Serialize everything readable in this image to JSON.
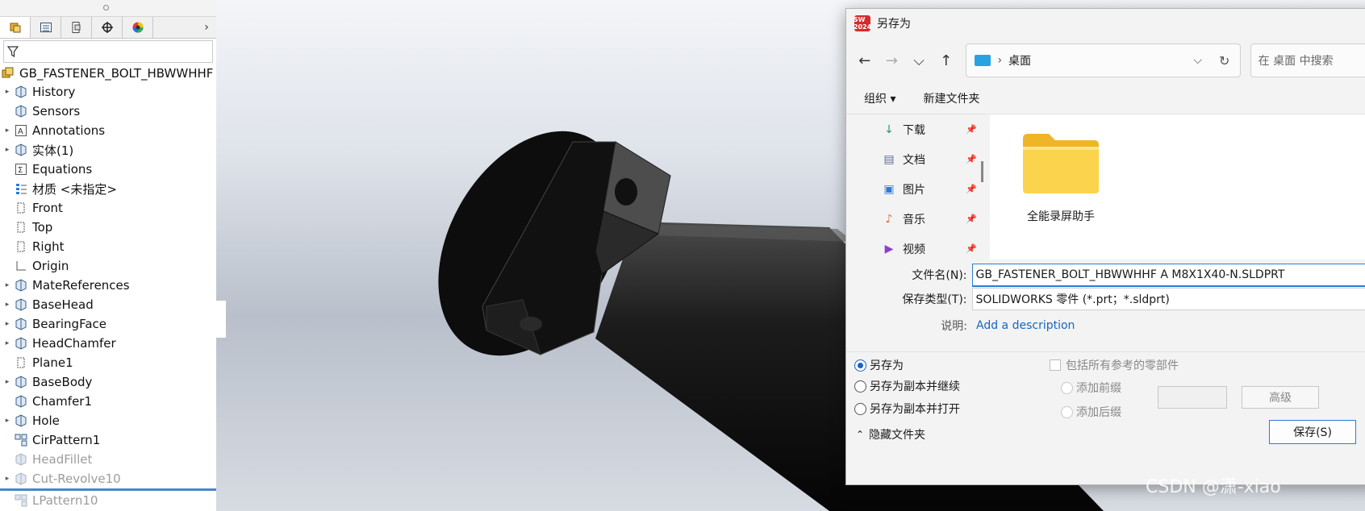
{
  "tree": {
    "tab_more": "›",
    "root_label": "GB_FASTENER_BOLT_HBWWHHF ...",
    "items": [
      {
        "label": "History",
        "expand": true
      },
      {
        "label": "Sensors",
        "expand": false
      },
      {
        "label": "Annotations",
        "expand": true
      },
      {
        "label": "实体(1)",
        "expand": true
      },
      {
        "label": "Equations",
        "expand": false
      },
      {
        "label": "材质 <未指定>",
        "expand": false
      },
      {
        "label": "Front",
        "expand": false
      },
      {
        "label": "Top",
        "expand": false
      },
      {
        "label": "Right",
        "expand": false
      },
      {
        "label": "Origin",
        "expand": false
      },
      {
        "label": "MateReferences",
        "expand": true
      },
      {
        "label": "BaseHead",
        "expand": true
      },
      {
        "label": "BearingFace",
        "expand": true
      },
      {
        "label": "HeadChamfer",
        "expand": true
      },
      {
        "label": "Plane1",
        "expand": false
      },
      {
        "label": "BaseBody",
        "expand": true
      },
      {
        "label": "Chamfer1",
        "expand": false
      },
      {
        "label": "Hole",
        "expand": true
      },
      {
        "label": "CirPattern1",
        "expand": false
      },
      {
        "label": "HeadFillet",
        "expand": false
      },
      {
        "label": "Cut-Revolve10",
        "expand": true
      },
      {
        "label": "LPattern10",
        "expand": false
      }
    ]
  },
  "dialog": {
    "title": "另存为",
    "logo_text": "SW 2024",
    "nav": {
      "back": "←",
      "forward": "→",
      "recent": "⌵",
      "up": "↑"
    },
    "address": {
      "chevron": "›",
      "current": "桌面",
      "dropdown": "⌵",
      "refresh": "↻"
    },
    "search_placeholder": "在 桌面 中搜索",
    "commands": {
      "organize": "组织 ▾",
      "new_folder": "新建文件夹"
    },
    "quick_access": [
      {
        "label": "下载",
        "icon": "download-icon",
        "color": "#1f9c6a"
      },
      {
        "label": "文档",
        "icon": "document-icon",
        "color": "#5b6f8f"
      },
      {
        "label": "图片",
        "icon": "picture-icon",
        "color": "#2d7bd6"
      },
      {
        "label": "音乐",
        "icon": "music-icon",
        "color": "#e26a3b"
      },
      {
        "label": "视频",
        "icon": "video-icon",
        "color": "#8a3fd1"
      }
    ],
    "pin_glyph": "📌",
    "folder_name": "全能录屏助手",
    "form": {
      "filename_label": "文件名(N):",
      "filename_value": "GB_FASTENER_BOLT_HBWWHHF A M8X1X40-N.SLDPRT",
      "filetype_label": "保存类型(T):",
      "filetype_value": "SOLIDWORKS 零件 (*.prt；*.sldprt)",
      "desc_label": "说明:",
      "desc_link": "Add a description"
    },
    "options": {
      "save_as": "另存为",
      "save_copy_continue": "另存为副本并继续",
      "save_copy_open": "另存为副本并打开",
      "include_refs": "包括所有参考的零部件",
      "add_prefix": "添加前缀",
      "add_suffix": "添加后缀",
      "advanced": "高级",
      "hide_folders": "隐藏文件夹",
      "save_button": "保存(S)"
    }
  },
  "watermark": "CSDN @潇-xiao"
}
